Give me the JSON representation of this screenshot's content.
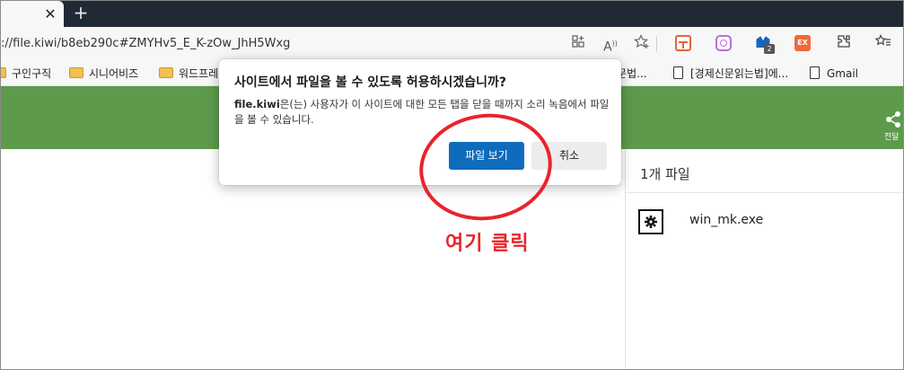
{
  "browser": {
    "new_tab": "+",
    "close_tab": "✕",
    "url": "://file.kiwi/b8eb290c#ZMYHv5_E_K-zOw_JhH5Wxg",
    "toolbar_icons": [
      "tab-icon",
      "read-aloud-icon",
      "favorite-add-icon"
    ],
    "read_aloud_label": "A",
    "extension_badge": "2",
    "extension_ex_label": "EX"
  },
  "bookmarks": [
    {
      "label": "구인구직",
      "type": "folder"
    },
    {
      "label": "시니어비즈",
      "type": "folder"
    },
    {
      "label": "워드프레",
      "type": "folder"
    },
    {
      "label": "/문법...",
      "type": "page"
    },
    {
      "label": "[경제신문읽는법]에...",
      "type": "page"
    },
    {
      "label": "Gmail",
      "type": "page"
    }
  ],
  "site": {
    "share_label": "전달",
    "file_count": "1개 파일",
    "file_name": "win_mk.exe"
  },
  "dialog": {
    "title": "사이트에서 파일을 볼 수 있도록 허용하시겠습니까?",
    "site_name": "file.kiwi",
    "message": "은(는) 사용자가 이 사이트에 대한 모든 탭을 닫을 때까지 소리 녹음에서 파일을 볼 수 있습니다.",
    "open_button": "파일 보기",
    "cancel_button": "취소"
  },
  "annotation": {
    "hint": "여기 클릭"
  },
  "colors": {
    "green_header": "#5d9a4c",
    "primary_button": "#0f6cbd",
    "annotation_red": "#e8242b"
  }
}
